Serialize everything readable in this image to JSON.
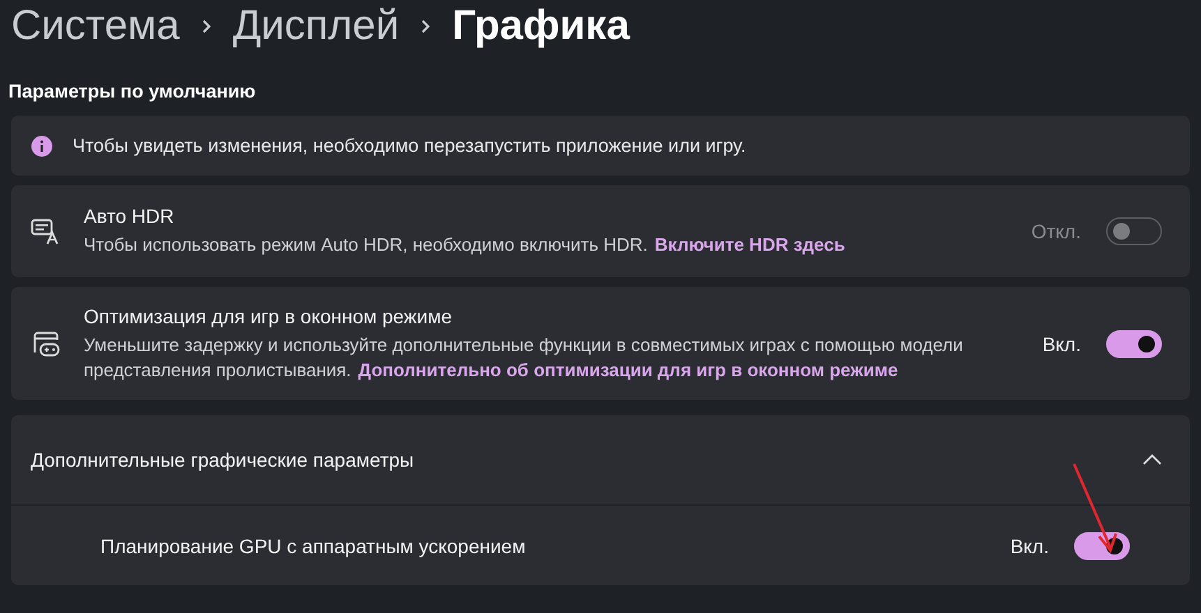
{
  "breadcrumb": [
    {
      "label": "Система",
      "current": false
    },
    {
      "label": "Дисплей",
      "current": false
    },
    {
      "label": "Графика",
      "current": true
    }
  ],
  "section_title": "Параметры по умолчанию",
  "info_bar": {
    "text": "Чтобы увидеть изменения, необходимо перезапустить приложение или игру."
  },
  "settings": [
    {
      "kind": "hdr",
      "title": "Авто HDR",
      "description": "Чтобы использовать режим Auto HDR, необходимо включить HDR.",
      "link": "Включите HDR здесь",
      "toggle": {
        "on": false,
        "disabled": true,
        "label": "Откл."
      }
    },
    {
      "kind": "game",
      "title": "Оптимизация для игр в оконном режиме",
      "description": "Уменьшите задержку и используйте дополнительные функции в совместимых играх с помощью модели представления пролистывания.",
      "link": "Дополнительно об оптимизации для игр в оконном режиме",
      "toggle": {
        "on": true,
        "disabled": false,
        "label": "Вкл."
      }
    }
  ],
  "expander": {
    "title": "Дополнительные графические параметры",
    "expanded": true,
    "items": [
      {
        "title": "Планирование GPU с аппаратным ускорением",
        "toggle": {
          "on": true,
          "disabled": false,
          "label": "Вкл."
        }
      }
    ]
  }
}
